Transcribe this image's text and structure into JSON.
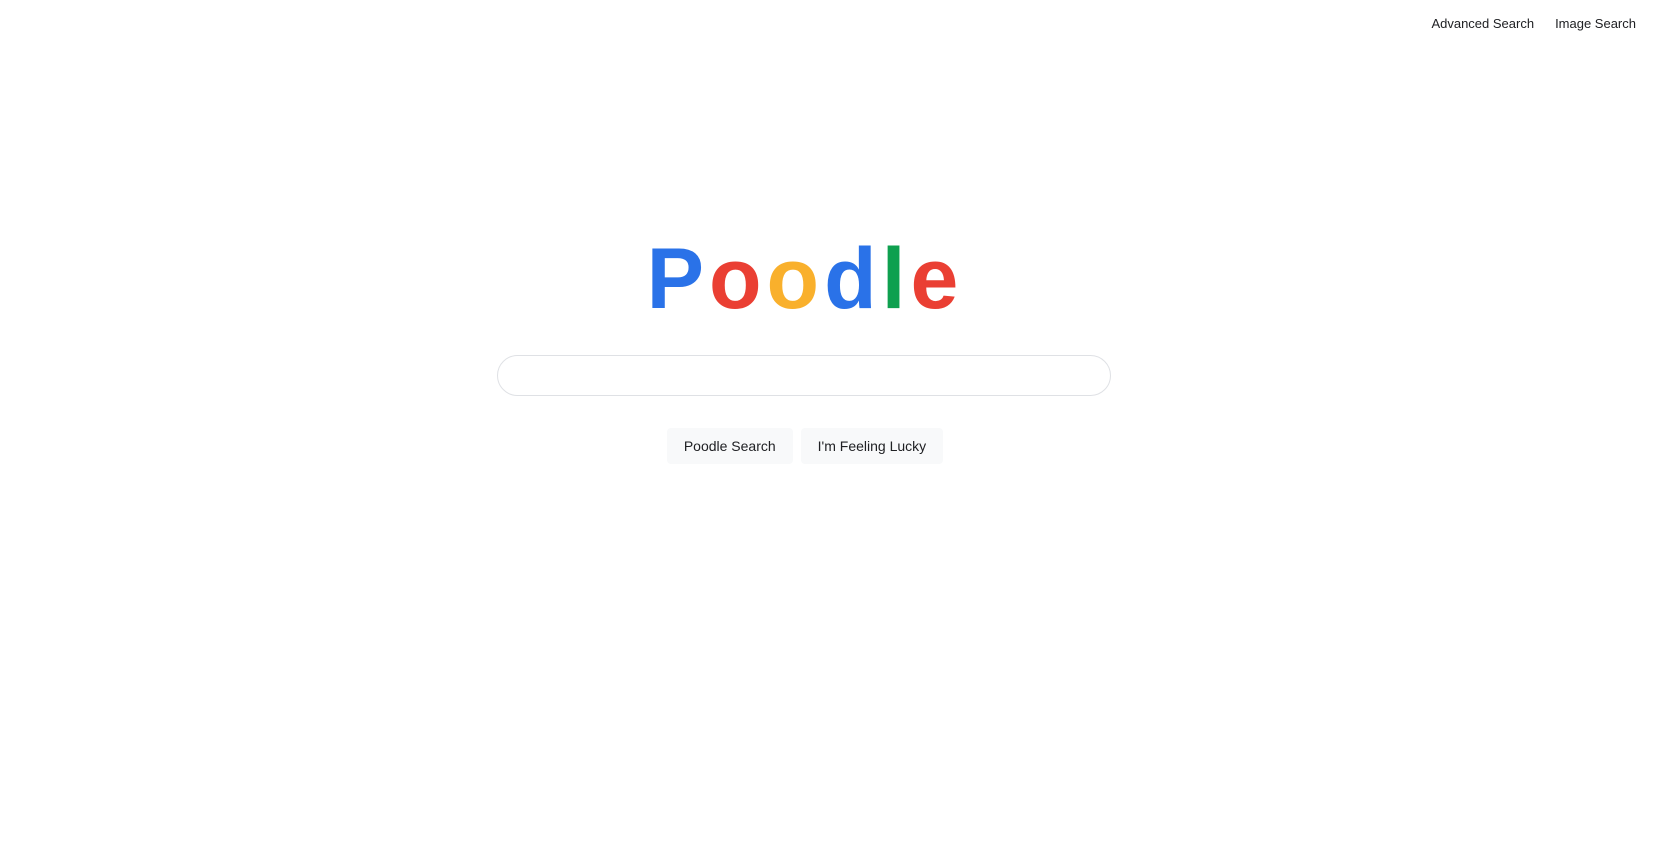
{
  "header": {
    "links": {
      "advanced_search": "Advanced Search",
      "image_search": "Image Search"
    }
  },
  "logo": {
    "letters": [
      {
        "char": "P",
        "color": "#2a72e8"
      },
      {
        "char": "o",
        "color": "#ea3f33"
      },
      {
        "char": "o",
        "color": "#f9b02c"
      },
      {
        "char": "d",
        "color": "#2a72e8"
      },
      {
        "char": "l",
        "color": "#0ea04f"
      },
      {
        "char": "e",
        "color": "#ea3f33"
      }
    ]
  },
  "search": {
    "value": "",
    "placeholder": ""
  },
  "buttons": {
    "search_label": "Poodle Search",
    "lucky_label": "I'm Feeling Lucky"
  }
}
